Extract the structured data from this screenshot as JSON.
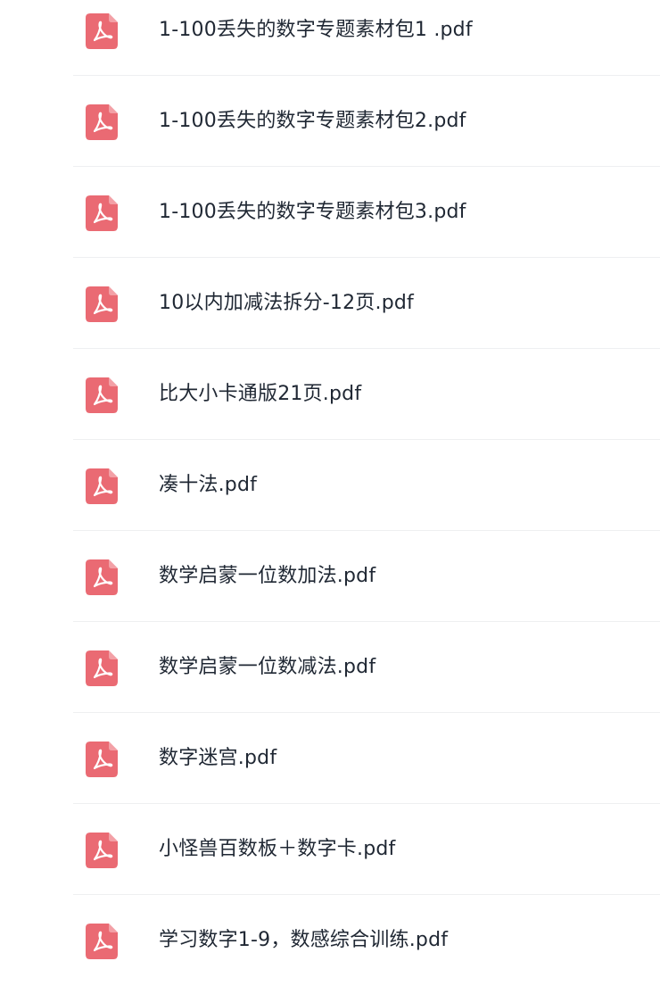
{
  "files": [
    {
      "name": "1-100丢失的数字专题素材包1 .pdf",
      "icon": "pdf-icon"
    },
    {
      "name": "1-100丢失的数字专题素材包2.pdf",
      "icon": "pdf-icon"
    },
    {
      "name": "1-100丢失的数字专题素材包3.pdf",
      "icon": "pdf-icon"
    },
    {
      "name": "10以内加减法拆分-12页.pdf",
      "icon": "pdf-icon"
    },
    {
      "name": "比大小卡通版21页.pdf",
      "icon": "pdf-icon"
    },
    {
      "name": "凑十法.pdf",
      "icon": "pdf-icon"
    },
    {
      "name": "数学启蒙一位数加法.pdf",
      "icon": "pdf-icon"
    },
    {
      "name": "数学启蒙一位数减法.pdf",
      "icon": "pdf-icon"
    },
    {
      "name": "数字迷宫.pdf",
      "icon": "pdf-icon"
    },
    {
      "name": "小怪兽百数板＋数字卡.pdf",
      "icon": "pdf-icon"
    },
    {
      "name": "学习数字1-9，数感综合训练.pdf",
      "icon": "pdf-icon"
    }
  ],
  "colors": {
    "pdf_icon": "#ea6a73",
    "text": "#1f2733",
    "divider": "#eeeff1"
  }
}
